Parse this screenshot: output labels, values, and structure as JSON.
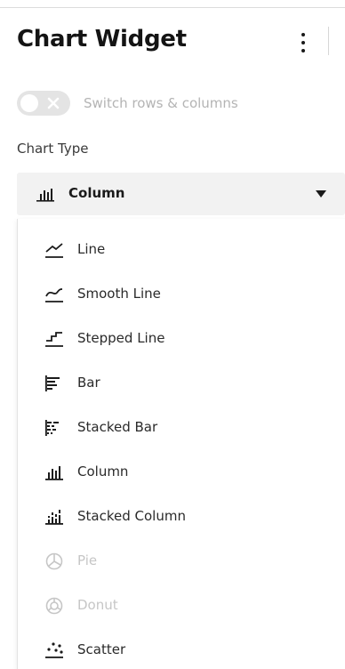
{
  "header": {
    "title": "Chart Widget",
    "menu_icon": "more-vertical-icon"
  },
  "switch": {
    "label": "Switch rows & columns",
    "checked": false
  },
  "chart_type": {
    "label": "Chart Type",
    "selected": {
      "label": "Column",
      "icon": "column-chart-icon"
    },
    "options": [
      {
        "label": "Line",
        "icon": "line-chart-icon",
        "enabled": true
      },
      {
        "label": "Smooth Line",
        "icon": "smooth-line-chart-icon",
        "enabled": true
      },
      {
        "label": "Stepped Line",
        "icon": "stepped-line-chart-icon",
        "enabled": true
      },
      {
        "label": "Bar",
        "icon": "bar-chart-icon",
        "enabled": true
      },
      {
        "label": "Stacked Bar",
        "icon": "stacked-bar-chart-icon",
        "enabled": true
      },
      {
        "label": "Column",
        "icon": "column-chart-icon",
        "enabled": true
      },
      {
        "label": "Stacked Column",
        "icon": "stacked-column-chart-icon",
        "enabled": true
      },
      {
        "label": "Pie",
        "icon": "pie-chart-icon",
        "enabled": false
      },
      {
        "label": "Donut",
        "icon": "donut-chart-icon",
        "enabled": false
      },
      {
        "label": "Scatter",
        "icon": "scatter-chart-icon",
        "enabled": true
      }
    ]
  },
  "colors": {
    "text": "#1a1a1a",
    "disabled": "#c6c6c6",
    "field_bg": "#f2f2f2",
    "toggle_bg": "#e4e4e4"
  }
}
